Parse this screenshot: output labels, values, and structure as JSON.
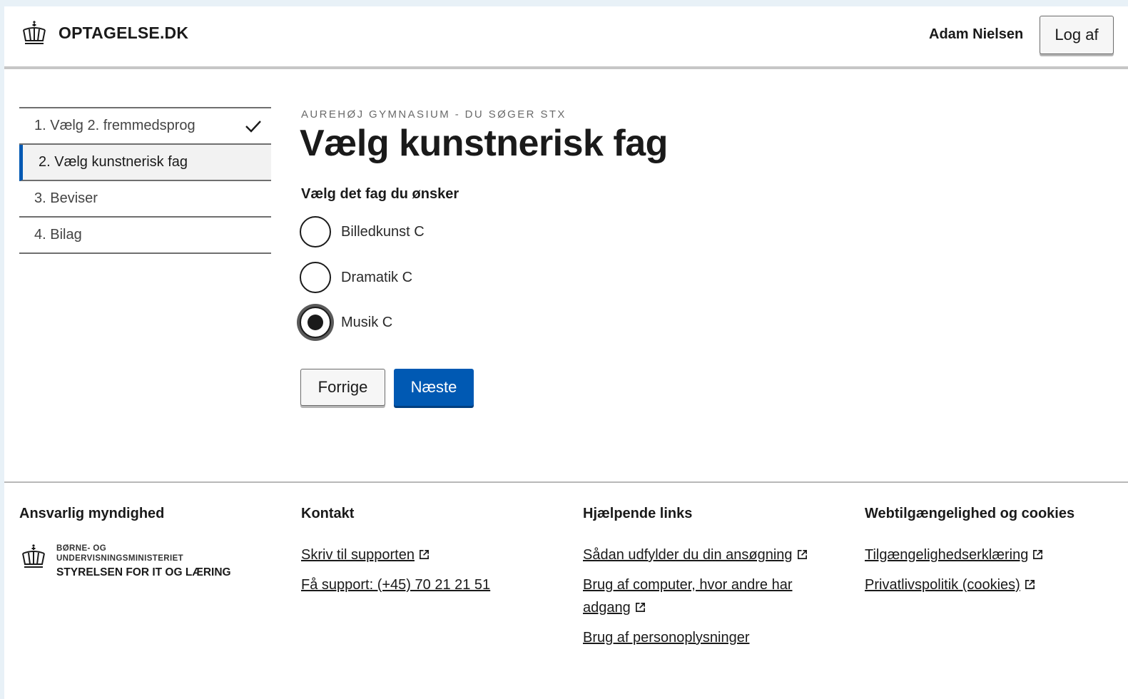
{
  "header": {
    "site_name": "OPTAGELSE.DK",
    "user_name": "Adam Nielsen",
    "logout_label": "Log af"
  },
  "steps": [
    {
      "label": "1. Vælg 2. fremmedsprog",
      "completed": true
    },
    {
      "label": "2. Vælg kunstnerisk fag",
      "active": true
    },
    {
      "label": "3. Beviser"
    },
    {
      "label": "4. Bilag"
    }
  ],
  "main": {
    "eyebrow": "AUREHØJ GYMNASIUM - DU SØGER STX",
    "title": "Vælg kunstnerisk fag",
    "legend": "Vælg det fag du ønsker",
    "options": [
      {
        "label": "Billedkunst C",
        "checked": false
      },
      {
        "label": "Dramatik C",
        "checked": false
      },
      {
        "label": "Musik C",
        "checked": true
      }
    ],
    "prev_label": "Forrige",
    "next_label": "Næste"
  },
  "footer": {
    "authority": {
      "heading": "Ansvarlig myndighed",
      "ministry_line1": "BØRNE- OG",
      "ministry_line2": "UNDERVISNINGSMINISTERIET",
      "agency": "STYRELSEN FOR IT OG LÆRING"
    },
    "contact": {
      "heading": "Kontakt",
      "links": [
        "Skriv til supporten",
        "Få support: (+45) 70 21 21 51"
      ]
    },
    "help": {
      "heading": "Hjælpende links",
      "links": [
        "Sådan udfylder du din ansøgning",
        "Brug af computer, hvor andre har adgang",
        "Brug af personoplysninger"
      ]
    },
    "accessibility": {
      "heading": "Webtilgængelighed og cookies",
      "links": [
        "Tilgængelighedserklæring",
        "Privatlivspolitik (cookies)"
      ]
    }
  },
  "colors": {
    "primary": "#0059b3",
    "page_background": "#e8f1f7"
  }
}
